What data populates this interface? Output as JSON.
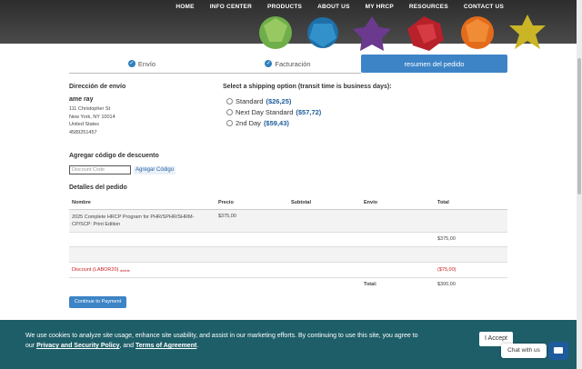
{
  "nav": {
    "items": [
      "HOME",
      "INFO CENTER",
      "PRODUCTS",
      "ABOUT US",
      "MY HRCP",
      "RESOURCES",
      "CONTACT US"
    ]
  },
  "tabs": {
    "envio": "Envío",
    "facturacion": "Facturación",
    "resumen": "resumen del pedido"
  },
  "address": {
    "title": "Dirección de envío",
    "name": "ame ray",
    "line1": "111 Christopher St",
    "line2": "New York, NY 10014",
    "line3": "United States",
    "phone": "4589251457"
  },
  "shipping": {
    "title": "Select a shipping option (transit time is business days):",
    "options": [
      {
        "label": "Standard",
        "price": "($26,25)"
      },
      {
        "label": "Next Day Standard",
        "price": "($57,72)"
      },
      {
        "label": "2nd Day",
        "price": "($59,43)"
      }
    ]
  },
  "discount": {
    "title": "Agregar código de descuento",
    "placeholder": "Discount Code",
    "button": "Agregar Código"
  },
  "order": {
    "title": "Detalles del pedido",
    "headers": {
      "nombre": "Nombre",
      "precio": "Precio",
      "subtotal": "Subtotal",
      "envio": "Envío",
      "total": "Total"
    },
    "item": {
      "name": "2025 Complete HRCP Program for PHR/SPHR/SHRM-CP/SCP: Print Edition",
      "price": "$375,00"
    },
    "subtotal_value": "$375,00",
    "discount_label": "Discount (LABOR20)",
    "discount_delete": "delete",
    "discount_value": "($75,00)",
    "total_label": "Total:",
    "total_value": "$300,00"
  },
  "continue_button": "Continue to Payment",
  "cookie": {
    "text1": "We use cookies to analyze site usage, enhance site usability, and assist in our marketing efforts. By continuing to use this site, you agree to our ",
    "link1": "Privacy and Security Policy",
    "text2": ", and ",
    "link2": "Terms of Agreement",
    "text3": ".",
    "accept": "I Accept"
  },
  "chat": {
    "label": "Chat with us"
  },
  "colors": {
    "accent": "#3d84c6",
    "banner": "#1e5e68",
    "discount": "#cc2222"
  }
}
